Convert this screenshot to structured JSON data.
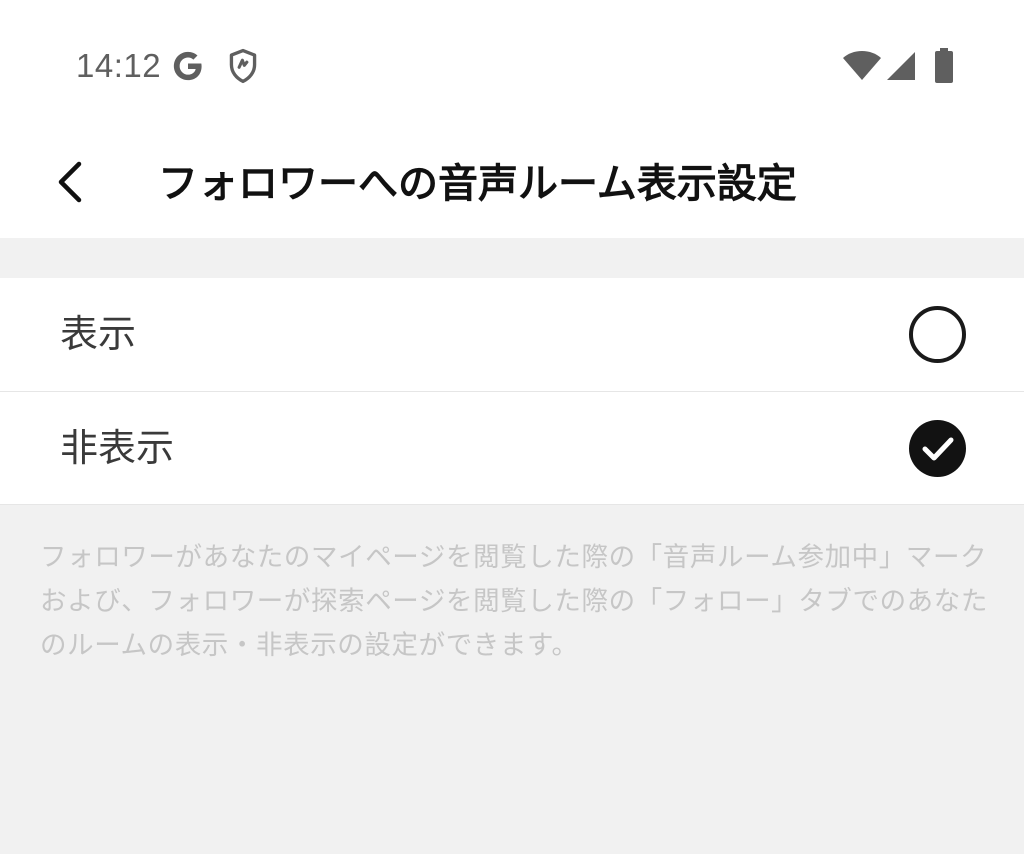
{
  "status_bar": {
    "time": "14:12",
    "icons_left": [
      "google-g-icon",
      "shield-icon"
    ],
    "icons_right": [
      "wifi-icon",
      "cell-signal-icon",
      "battery-icon"
    ]
  },
  "app_bar": {
    "back_icon": "chevron-left-icon",
    "title": "フォロワーへの音声ルーム表示設定"
  },
  "options": [
    {
      "label": "表示",
      "selected": false
    },
    {
      "label": "非表示",
      "selected": true
    }
  ],
  "description": "フォロワーがあなたのマイページを閲覧した際の「音声ルーム参加中」マークおよび、フォロワーが探索ページを閲覧した際の「フォロー」タブでのあなたのルームの表示・非表示の設定ができます。",
  "colors": {
    "background": "#f1f1f1",
    "surface": "#ffffff",
    "text_primary": "#111111",
    "text_option": "#3a3a3a",
    "text_muted": "#c6c6c6",
    "status_icon": "#5f5f5f"
  }
}
